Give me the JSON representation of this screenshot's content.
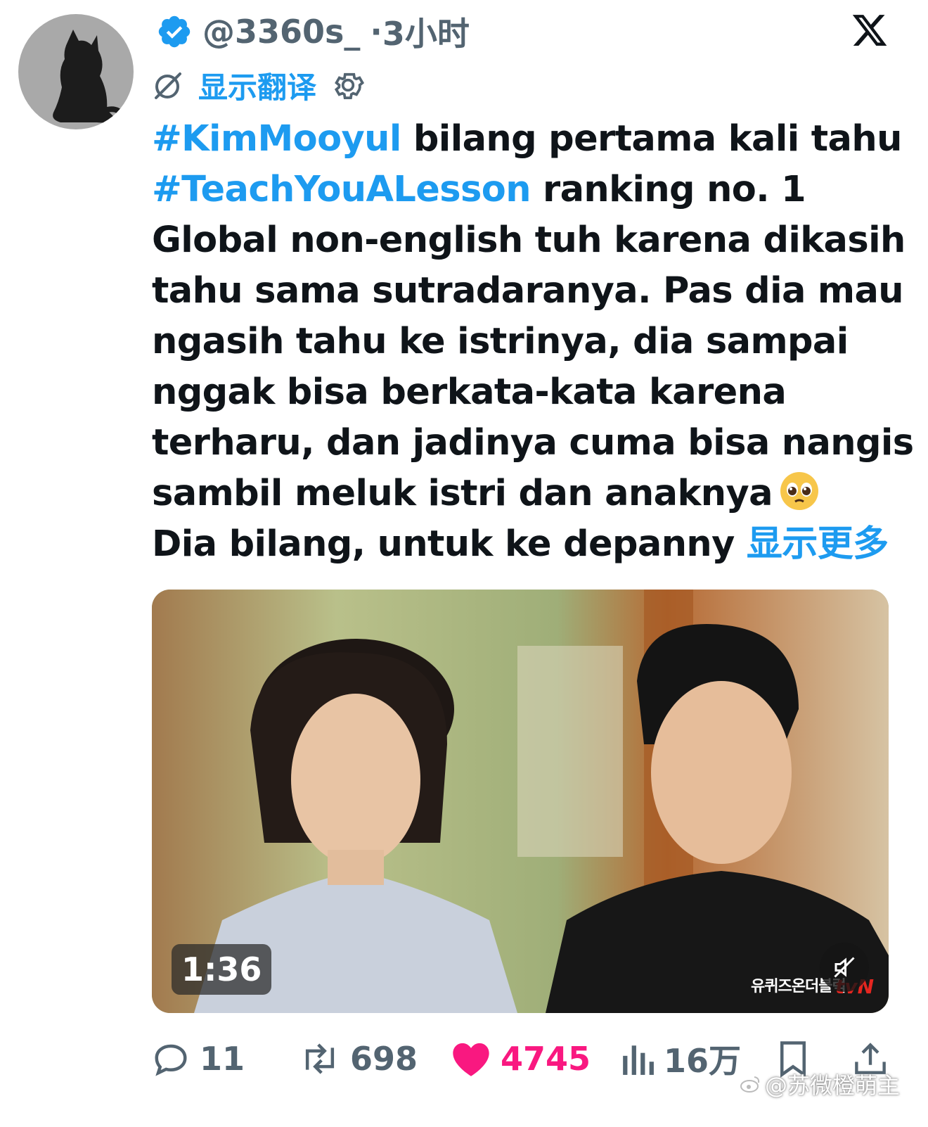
{
  "tweet": {
    "handle": "@3360s_",
    "separator": "·",
    "time": "3小时",
    "verified": true,
    "translate_label": "显示翻译",
    "text_lines": [
      {
        "hashtag": "#KimMooyul",
        "rest": " bilang pertama kali tahu"
      },
      {
        "hashtag": "#TeachYouALesson",
        "rest": " ranking no. 1"
      },
      {
        "text": "Global non-english tuh karena dikasih"
      },
      {
        "text": "tahu sama sutradaranya. Pas dia mau"
      },
      {
        "text": "ngasih tahu ke istrinya, dia sampai"
      },
      {
        "text": "nggak bisa berkata-kata karena"
      },
      {
        "text": "terharu, dan jadinya cuma bisa nangis"
      },
      {
        "text": "sambil meluk istri dan anaknya",
        "emoji": "pleading-face-emoji"
      },
      {
        "text": "Dia bilang, untuk ke depanny ",
        "show_more": "显示更多"
      }
    ]
  },
  "media": {
    "duration": "1:36",
    "show_logo": "유퀴즈온더블럭",
    "channel_logo": "tvN",
    "muted": true
  },
  "actions": {
    "replies": "11",
    "retweets": "698",
    "likes": "4745",
    "views": "16万"
  },
  "watermark": "@苏微橙萌主",
  "colors": {
    "accent": "#1d9bf0",
    "like": "#f91880",
    "muted_text": "#536471",
    "text": "#0f1419"
  },
  "icons": [
    "verified-badge-icon",
    "x-logo-icon",
    "translate-icon",
    "gear-icon",
    "reply-icon",
    "retweet-icon",
    "heart-icon",
    "views-icon",
    "bookmark-icon",
    "share-icon",
    "mute-icon",
    "weibo-icon"
  ]
}
